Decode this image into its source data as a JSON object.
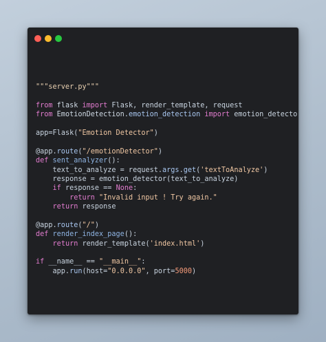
{
  "window": {
    "controls": [
      {
        "name": "close",
        "color": "#ff5f57"
      },
      {
        "name": "minimize",
        "color": "#febc2e"
      },
      {
        "name": "maximize",
        "color": "#28c840"
      }
    ]
  },
  "code": {
    "language": "python",
    "lines": [
      [
        {
          "t": "\"\"\"server.py\"\"\"",
          "k": "docstring"
        }
      ],
      [],
      [
        {
          "t": "from ",
          "k": "keyword"
        },
        {
          "t": "flask ",
          "k": "module"
        },
        {
          "t": "import ",
          "k": "keyword"
        },
        {
          "t": "Flask, render_template, request",
          "k": "plain"
        }
      ],
      [
        {
          "t": "from ",
          "k": "keyword"
        },
        {
          "t": "EmotionDetection",
          "k": "module"
        },
        {
          "t": ".",
          "k": "punct"
        },
        {
          "t": "emotion_detection ",
          "k": "attr"
        },
        {
          "t": "import ",
          "k": "keyword"
        },
        {
          "t": "emotion_detector",
          "k": "plain"
        }
      ],
      [],
      [
        {
          "t": "app",
          "k": "plain"
        },
        {
          "t": "=",
          "k": "punct"
        },
        {
          "t": "Flask",
          "k": "plain"
        },
        {
          "t": "(",
          "k": "punct"
        },
        {
          "t": "\"Emotion Detector\"",
          "k": "string"
        },
        {
          "t": ")",
          "k": "punct"
        }
      ],
      [],
      [
        {
          "t": "@app.",
          "k": "decorator"
        },
        {
          "t": "route",
          "k": "attr"
        },
        {
          "t": "(",
          "k": "punct"
        },
        {
          "t": "\"/emotionDetector\"",
          "k": "string"
        },
        {
          "t": ")",
          "k": "punct"
        }
      ],
      [
        {
          "t": "def ",
          "k": "keyword"
        },
        {
          "t": "sent_analyzer",
          "k": "func"
        },
        {
          "t": "():",
          "k": "punct"
        }
      ],
      [
        {
          "t": "    text_to_analyze = request.",
          "k": "plain"
        },
        {
          "t": "args",
          "k": "attr"
        },
        {
          "t": ".",
          "k": "punct"
        },
        {
          "t": "get",
          "k": "attr"
        },
        {
          "t": "(",
          "k": "punct"
        },
        {
          "t": "'textToAnalyze'",
          "k": "string"
        },
        {
          "t": ")",
          "k": "punct"
        }
      ],
      [
        {
          "t": "    response = emotion_detector(text_to_analyze)",
          "k": "plain"
        }
      ],
      [
        {
          "t": "    ",
          "k": "plain"
        },
        {
          "t": "if ",
          "k": "keyword"
        },
        {
          "t": "response == ",
          "k": "plain"
        },
        {
          "t": "None",
          "k": "const"
        },
        {
          "t": ":",
          "k": "punct"
        }
      ],
      [
        {
          "t": "        ",
          "k": "plain"
        },
        {
          "t": "return ",
          "k": "keyword"
        },
        {
          "t": "\"Invalid input ! Try again.\"",
          "k": "string"
        }
      ],
      [
        {
          "t": "    ",
          "k": "plain"
        },
        {
          "t": "return ",
          "k": "keyword"
        },
        {
          "t": "response",
          "k": "plain"
        }
      ],
      [],
      [
        {
          "t": "@app.",
          "k": "decorator"
        },
        {
          "t": "route",
          "k": "attr"
        },
        {
          "t": "(",
          "k": "punct"
        },
        {
          "t": "\"/\"",
          "k": "string"
        },
        {
          "t": ")",
          "k": "punct"
        }
      ],
      [
        {
          "t": "def ",
          "k": "keyword"
        },
        {
          "t": "render_index_page",
          "k": "func"
        },
        {
          "t": "():",
          "k": "punct"
        }
      ],
      [
        {
          "t": "    ",
          "k": "plain"
        },
        {
          "t": "return ",
          "k": "keyword"
        },
        {
          "t": "render_template(",
          "k": "plain"
        },
        {
          "t": "'index.html'",
          "k": "string"
        },
        {
          "t": ")",
          "k": "punct"
        }
      ],
      [],
      [
        {
          "t": "if ",
          "k": "keyword"
        },
        {
          "t": "__name__ == ",
          "k": "plain"
        },
        {
          "t": "\"__main__\"",
          "k": "string"
        },
        {
          "t": ":",
          "k": "punct"
        }
      ],
      [
        {
          "t": "    app.",
          "k": "plain"
        },
        {
          "t": "run",
          "k": "attr"
        },
        {
          "t": "(host=",
          "k": "plain"
        },
        {
          "t": "\"0.0.0.0\"",
          "k": "string"
        },
        {
          "t": ", port=",
          "k": "plain"
        },
        {
          "t": "5000",
          "k": "number"
        },
        {
          "t": ")",
          "k": "punct"
        }
      ]
    ]
  }
}
